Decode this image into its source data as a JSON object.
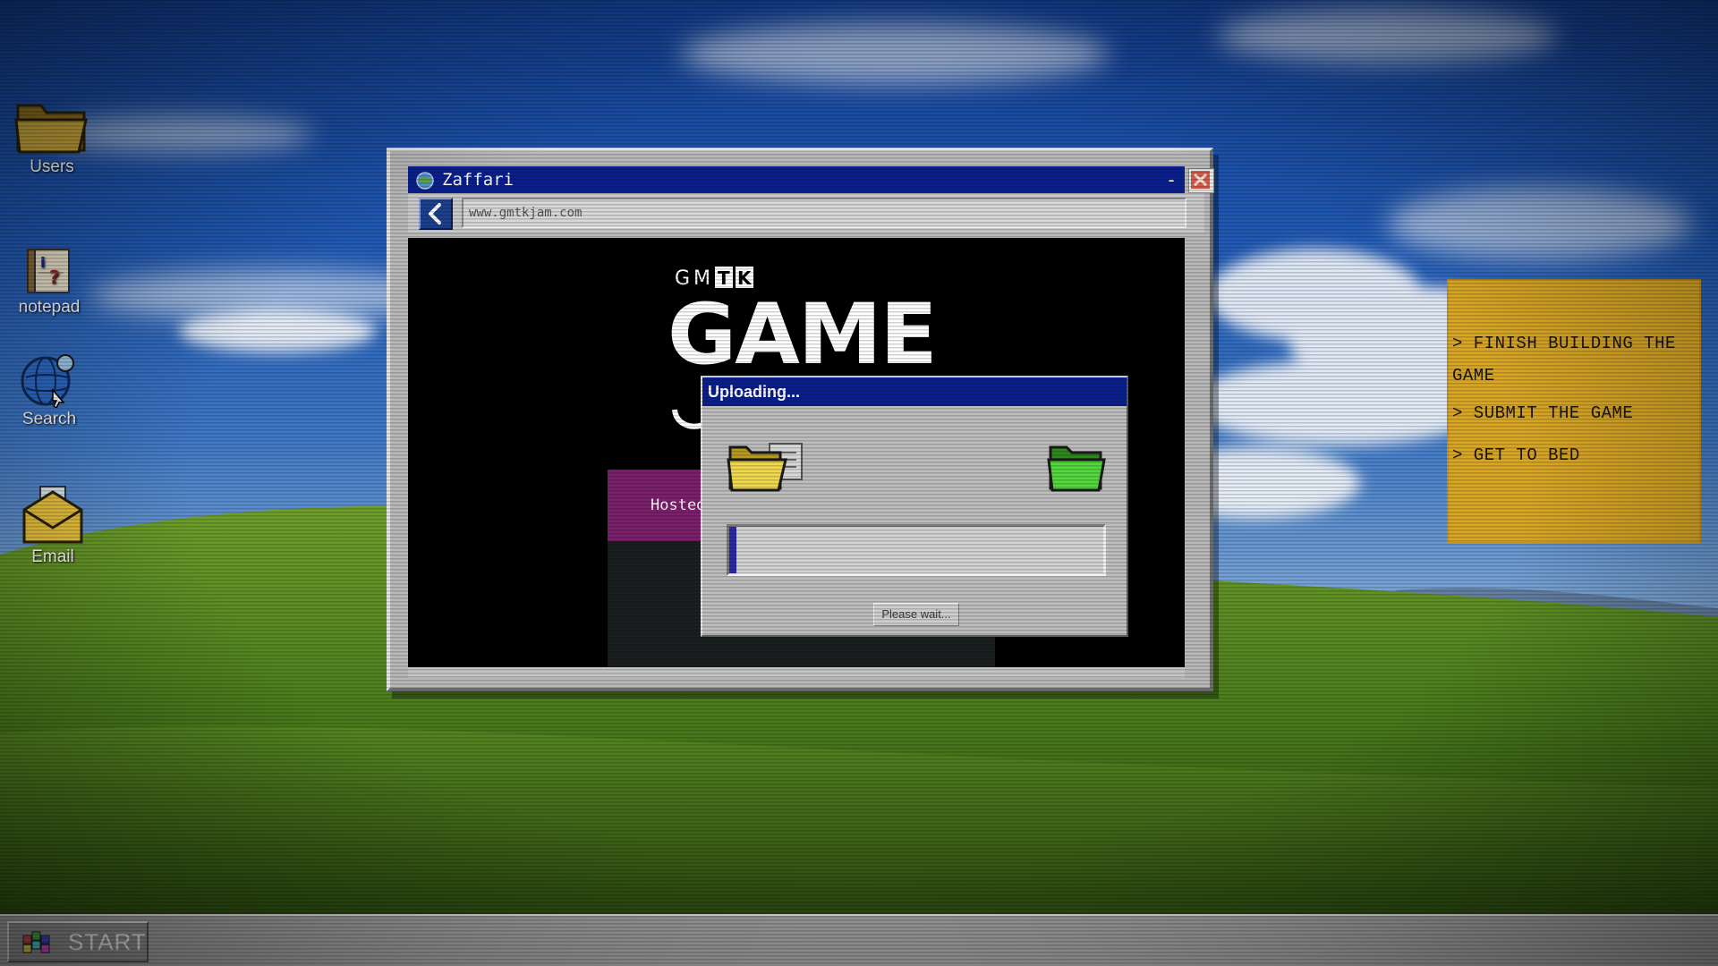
{
  "desktop": {
    "icons": [
      {
        "label": "Users",
        "icon": "folder-icon"
      },
      {
        "label": "notepad",
        "icon": "notepad-icon"
      },
      {
        "label": "Search",
        "icon": "globe-search-icon"
      },
      {
        "label": "Email",
        "icon": "email-envelope-icon"
      }
    ]
  },
  "browser": {
    "title": "Zaffari",
    "minimize_glyph": "-",
    "url": "www.gmtkjam.com",
    "content": {
      "logo_prefix_g": "G",
      "logo_prefix_m": "M",
      "logo_prefix_t": "T",
      "logo_prefix_k": "K",
      "logo_main": "GAME",
      "hosted_text": "Hosted"
    }
  },
  "upload_dialog": {
    "title": "Uploading...",
    "progress_fraction": 0.02,
    "button_label": "Please wait..."
  },
  "sticky_note": {
    "tasks": [
      "> FINISH  BUILDING THE GAME",
      "> SUBMIT THE GAME",
      "> GET TO BED"
    ]
  },
  "taskbar": {
    "start_label": "START"
  },
  "colors": {
    "title_bar": "#0a1f8f",
    "sticky_note": "#d9a623",
    "hosted_banner": "#7c1f6c",
    "progress_fill": "#2a2aa8"
  }
}
